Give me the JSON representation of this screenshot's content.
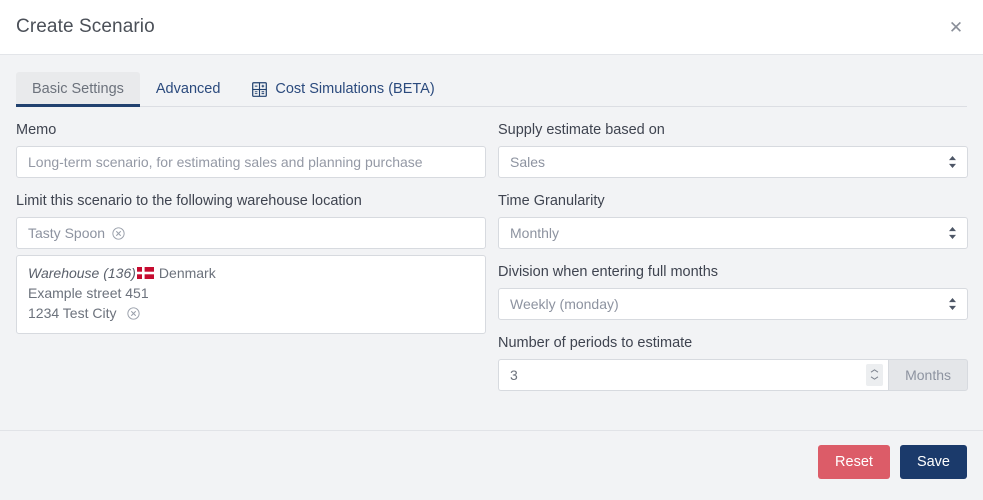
{
  "header": {
    "title": "Create Scenario",
    "close_label": "✕"
  },
  "tabs": [
    {
      "label": "Basic Settings",
      "active": true,
      "icon": ""
    },
    {
      "label": "Advanced",
      "active": false,
      "icon": ""
    },
    {
      "label": "Cost Simulations (BETA)",
      "active": false,
      "icon": "calculator-icon"
    }
  ],
  "form": {
    "memo": {
      "label": "Memo",
      "value": "",
      "placeholder": "Long-term scenario, for estimating sales and planning purchase"
    },
    "warehouse": {
      "label": "Limit this scenario to the following warehouse location",
      "token": "Tasty Spoon",
      "remove_icon": "remove-circle-icon",
      "address": {
        "name": "Warehouse (136)",
        "country": "Denmark",
        "country_flag": "denmark-flag-icon",
        "street": "Example street 451",
        "city": "1234 Test City",
        "remove_icon": "remove-circle-icon"
      }
    },
    "supply_estimate": {
      "label": "Supply estimate based on",
      "value": "Sales"
    },
    "time_granularity": {
      "label": "Time Granularity",
      "value": "Monthly"
    },
    "division": {
      "label": "Division when entering full months",
      "value": "Weekly (monday)"
    },
    "periods": {
      "label": "Number of periods to estimate",
      "value": "3",
      "unit": "Months"
    }
  },
  "footer": {
    "reset_label": "Reset",
    "save_label": "Save"
  },
  "colors": {
    "accent_navy": "#1b3a6b",
    "danger_red": "#dc5c68",
    "tab_link": "#2b4a7d",
    "page_bg": "#f2f3f5",
    "flag_red": "#c60c30"
  }
}
